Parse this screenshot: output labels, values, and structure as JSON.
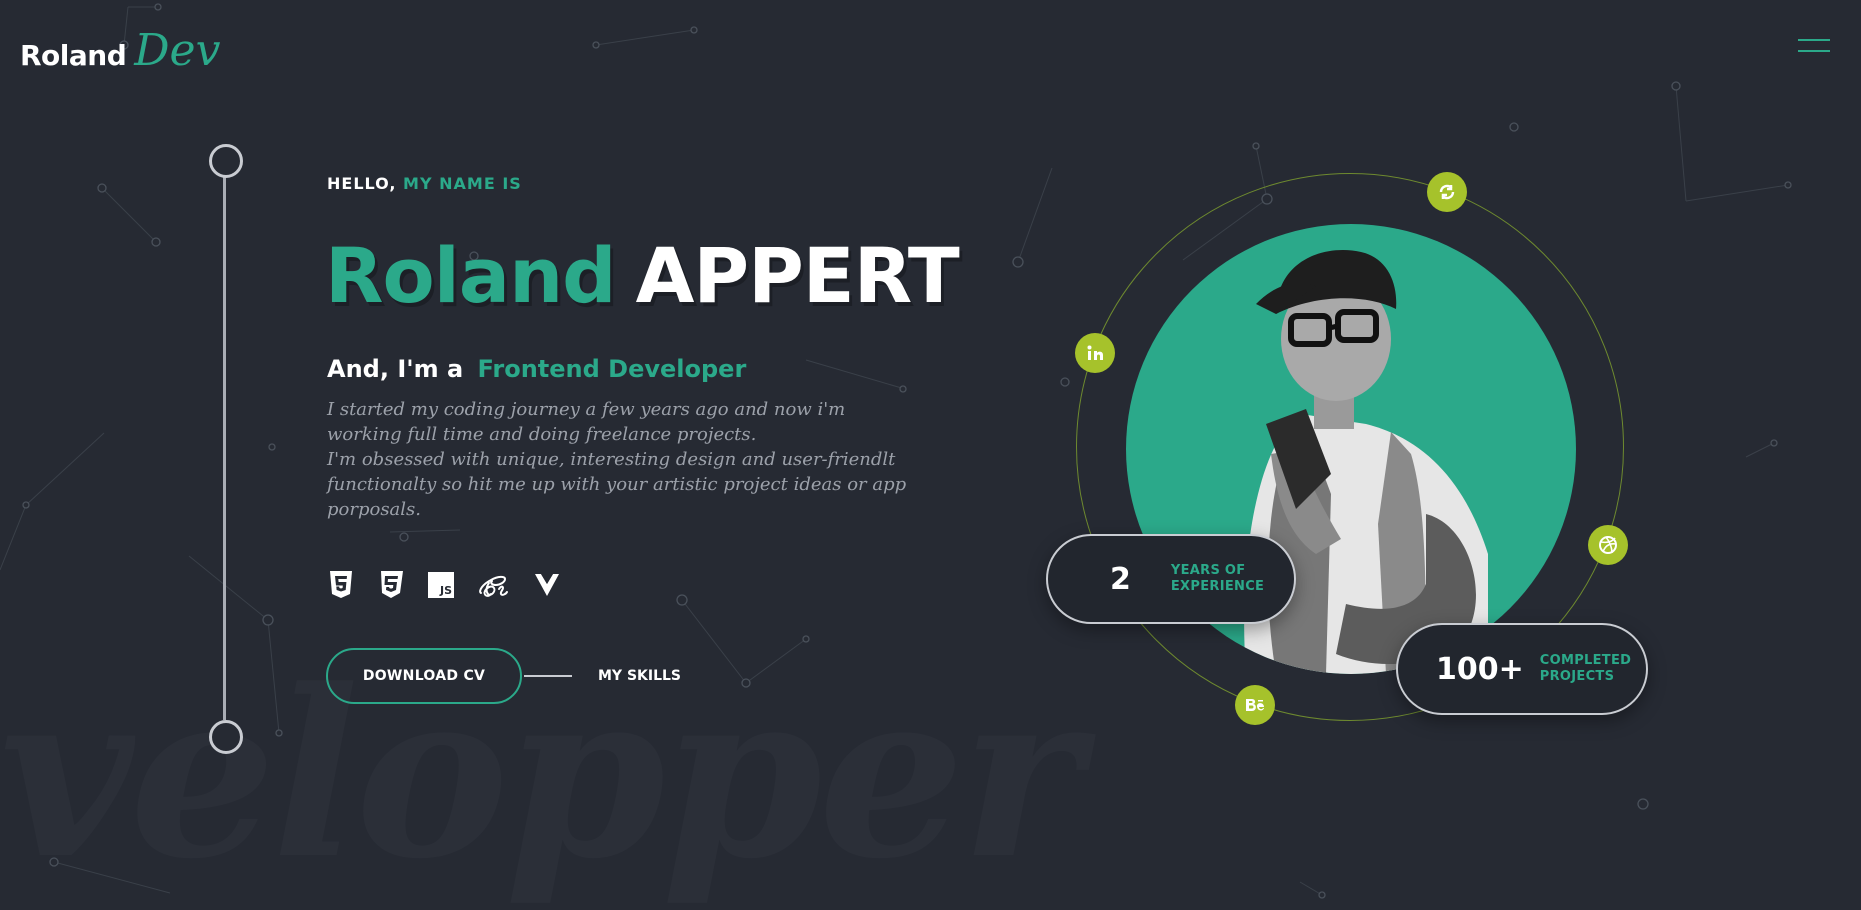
{
  "header": {
    "logo_main": "Roland",
    "logo_accent": "Dev",
    "menu_icon": "hamburger-icon"
  },
  "hero": {
    "greeting_prefix": "HELLO,",
    "greeting_accent": "MY NAME IS",
    "first_name": "Roland",
    "last_name": "APPERT",
    "role_prefix": "And, I'm a",
    "role_accent": "Frontend Developer",
    "bio_line1": "I started my coding journey a few years ago and now i'm working full time and doing freelance projects.",
    "bio_line2": "I'm obsessed with unique, interesting design and user-friendlt functionalty so hit me up with your artistic project ideas or app porposals.",
    "tech_icons": [
      "html5-icon",
      "css3-icon",
      "javascript-icon",
      "sass-icon",
      "vue-icon"
    ],
    "js_badge": "JS",
    "download_cv_label": "DOWNLOAD CV",
    "my_skills_label": "MY SKILLS",
    "watermark": "velopper"
  },
  "profile": {
    "social_icons": [
      "codepen-icon",
      "linkedin-icon",
      "dribbble-icon",
      "behance-icon"
    ],
    "stats": [
      {
        "value": "2",
        "label_line1": "YEARS OF",
        "label_line2": "EXPERIENCE"
      },
      {
        "value": "100+",
        "label_line1": "COMPLETED",
        "label_line2": "PROJECTS"
      }
    ]
  },
  "colors": {
    "background": "#262a33",
    "accent": "#2ba98a",
    "social_badge": "#a6c22b"
  }
}
